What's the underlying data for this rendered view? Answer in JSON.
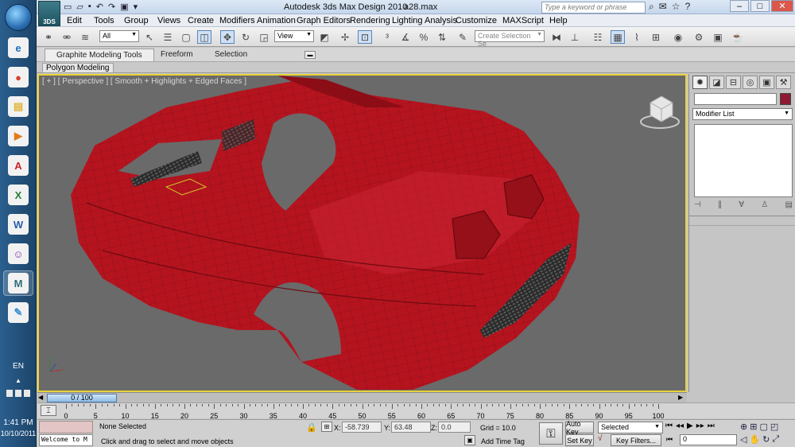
{
  "taskbar": {
    "apps": [
      {
        "name": "ie",
        "glyph": "e",
        "color": "#1e6fbf"
      },
      {
        "name": "chrome",
        "glyph": "●",
        "color": "#d9412c"
      },
      {
        "name": "explorer",
        "glyph": "▤",
        "color": "#e2b43a"
      },
      {
        "name": "media-player",
        "glyph": "▶",
        "color": "#e07b1b"
      },
      {
        "name": "acrobat",
        "glyph": "A",
        "color": "#c8262b"
      },
      {
        "name": "excel",
        "glyph": "X",
        "color": "#2a7f3c"
      },
      {
        "name": "word",
        "glyph": "W",
        "color": "#2a5fad"
      },
      {
        "name": "messenger",
        "glyph": "☺",
        "color": "#7b3aa8"
      },
      {
        "name": "3dsmax",
        "glyph": "M",
        "color": "#2e6f79"
      },
      {
        "name": "paint",
        "glyph": "✎",
        "color": "#3a8ed0"
      }
    ],
    "language": "EN",
    "time": "1:41 PM",
    "date": "10/10/2011"
  },
  "titlebar": {
    "app_title": "Autodesk 3ds Max Design 2010",
    "file_title": "a28.max",
    "search_placeholder": "Type a keyword or phrase",
    "logo_text": "3DS"
  },
  "menu": [
    "Edit",
    "Tools",
    "Group",
    "Views",
    "Create",
    "Modifiers",
    "Animation",
    "Graph Editors",
    "Rendering",
    "Lighting Analysis",
    "Customize",
    "MAXScript",
    "Help"
  ],
  "toolbar": {
    "selection_filter": "All",
    "ref_coord": "View",
    "named_selection_placeholder": "Create Selection Se"
  },
  "ribbon": {
    "tabs": [
      "Graphite Modeling Tools",
      "Freeform",
      "Selection"
    ],
    "panel_label": "Polygon Modeling"
  },
  "viewport": {
    "label": "[ + ] [ Perspective ] [ Smooth + Highlights + Edged Faces ]",
    "object_color": "#b5141f"
  },
  "command_panel": {
    "modifier_list": "Modifier List",
    "object_color": "#8e1a33"
  },
  "time_slider": {
    "label": "0 / 100",
    "current": 0,
    "total": 100
  },
  "track_bar": {
    "ticks": [
      "0",
      "5",
      "10",
      "15",
      "20",
      "25",
      "30",
      "35",
      "40",
      "45",
      "50",
      "55",
      "60",
      "65",
      "70",
      "75",
      "80",
      "85",
      "90",
      "95",
      "100"
    ]
  },
  "status": {
    "maxscript_listener": "Welcome to M",
    "selection": "None Selected",
    "prompt": "Click and drag to select and move objects",
    "x_label": "X:",
    "x_value": "-58.739",
    "y_label": "Y:",
    "y_value": "63.48",
    "z_label": "Z:",
    "z_value": "0.0",
    "grid": "Grid = 10.0",
    "add_time_tag": "Add Time Tag",
    "auto_key": "Auto Key",
    "set_key": "Set Key",
    "selected_dropdown": "Selected",
    "key_filters": "Key Filters...",
    "frame_value": "0"
  }
}
